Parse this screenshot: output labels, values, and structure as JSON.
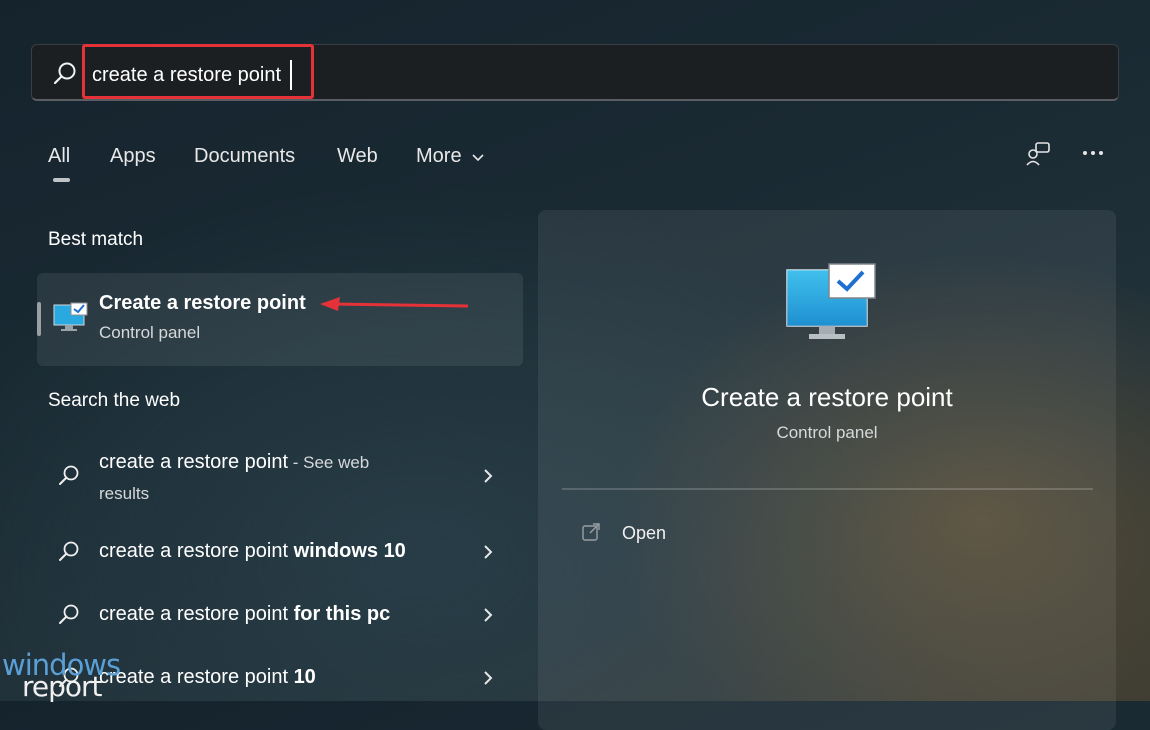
{
  "search": {
    "value": "create a restore point"
  },
  "tabs": [
    {
      "label": "All"
    },
    {
      "label": "Apps"
    },
    {
      "label": "Documents"
    },
    {
      "label": "Web"
    },
    {
      "label": "More"
    }
  ],
  "best_match": {
    "heading": "Best match",
    "title": "Create a restore point",
    "subtitle": "Control panel"
  },
  "web": {
    "heading": "Search the web",
    "items": [
      {
        "prefix": "create a restore point",
        "bold": "",
        "suffix": " - See web",
        "suffix2": "results"
      },
      {
        "prefix": "create a restore point ",
        "bold": "windows 10"
      },
      {
        "prefix": "create a restore point ",
        "bold": "for this pc"
      },
      {
        "prefix": "create a restore point ",
        "bold": "10"
      }
    ]
  },
  "panel": {
    "title": "Create a restore point",
    "subtitle": "Control panel",
    "open_label": "Open"
  },
  "watermark": {
    "line1": "windows",
    "line2": "report"
  },
  "colors": {
    "highlight": "#e53238",
    "arrow": "#e53238",
    "monitor": "#2aa8e0",
    "check": "#1e6fd0"
  },
  "icons": [
    "search-icon",
    "monitor-check-icon",
    "chevron-down-icon",
    "chevron-right-icon",
    "feedback-icon",
    "more-icon",
    "open-external-icon"
  ]
}
